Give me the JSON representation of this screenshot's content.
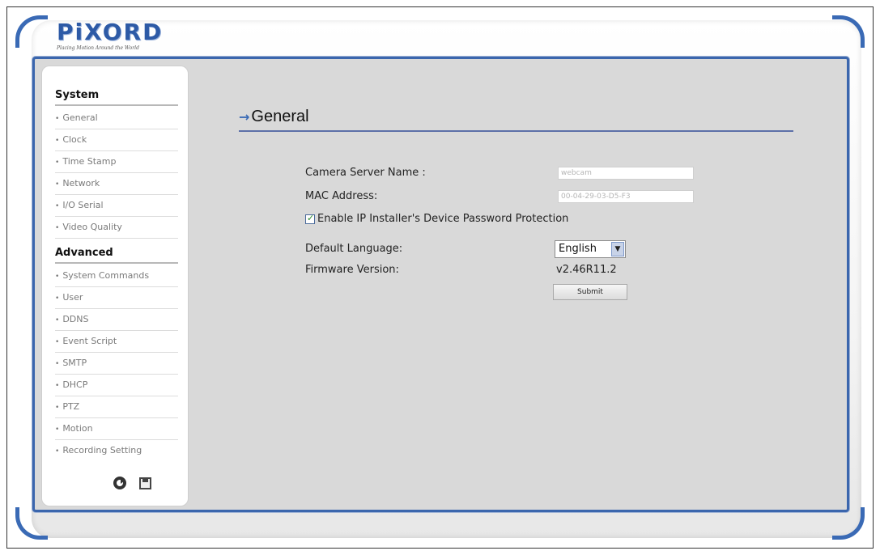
{
  "brand": {
    "logo_text": "PiXORD",
    "tagline": "Placing Motion Around the World"
  },
  "sidebar": {
    "system_title": "System",
    "system_items": [
      {
        "label": "General"
      },
      {
        "label": "Clock"
      },
      {
        "label": "Time Stamp"
      },
      {
        "label": "Network"
      },
      {
        "label": "I/O Serial"
      },
      {
        "label": "Video Quality"
      }
    ],
    "advanced_title": "Advanced",
    "advanced_items": [
      {
        "label": "System Commands"
      },
      {
        "label": "User"
      },
      {
        "label": "DDNS"
      },
      {
        "label": "Event Script"
      },
      {
        "label": "SMTP"
      },
      {
        "label": "DHCP"
      },
      {
        "label": "PTZ"
      },
      {
        "label": "Motion"
      },
      {
        "label": "Recording Setting"
      }
    ],
    "bullet": "•",
    "icons": [
      "refresh-icon",
      "save-icon"
    ]
  },
  "main": {
    "title_arrow": "→",
    "title": "General",
    "camera_name_label": "Camera Server Name :",
    "camera_name_value": "webcam",
    "mac_label": "MAC Address:",
    "mac_value": "00-04-29-03-D5-F3",
    "password_protection_label": "Enable IP Installer's Device Password Protection",
    "password_protection_checked": true,
    "language_label": "Default Language:",
    "language_value": "English",
    "firmware_label": "Firmware Version:",
    "firmware_value": "v2.46R11.2",
    "submit_label": "Submit"
  },
  "colors": {
    "accent": "#3b66ad",
    "panel_bg": "#d9d9d9"
  }
}
